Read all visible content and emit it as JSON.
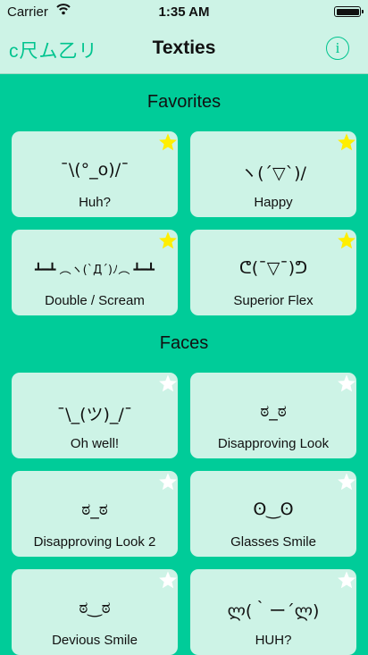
{
  "status_bar": {
    "carrier": "Carrier",
    "time": "1:35 AM"
  },
  "nav": {
    "left_button": "c尺ム乙リ",
    "title": "Texties",
    "info_button": "i"
  },
  "colors": {
    "background": "#00cc99",
    "card": "#cdf3e6",
    "accent": "#00c48f",
    "star_favorite": "#ffee00",
    "star_empty": "#ffffff"
  },
  "sections": [
    {
      "title": "Favorites",
      "items": [
        {
          "face": "¯\\(°_o)/¯",
          "label": "Huh?",
          "favorite": true,
          "star_icon": "star-filled-icon"
        },
        {
          "face": "ヽ(´▽`)/",
          "label": "Happy",
          "favorite": true,
          "star_icon": "star-filled-icon"
        },
        {
          "face": "┻━┻ ︵ヽ(`Д´)ﾉ︵ ┻━┻",
          "label": "Double / Scream",
          "favorite": true,
          "star_icon": "star-filled-icon"
        },
        {
          "face": "ᕦ(¯▽¯)ᕤ",
          "label": "Superior Flex",
          "favorite": true,
          "star_icon": "star-filled-icon"
        }
      ]
    },
    {
      "title": "Faces",
      "items": [
        {
          "face": "¯\\_(ツ)_/¯",
          "label": "Oh well!",
          "favorite": false,
          "star_icon": "star-empty-icon"
        },
        {
          "face": "ಠ_ಠ",
          "label": "Disapproving Look",
          "favorite": false,
          "star_icon": "star-empty-icon"
        },
        {
          "face": "ಠ_ಠ",
          "label": "Disapproving Look 2",
          "favorite": false,
          "star_icon": "star-empty-icon"
        },
        {
          "face": "ʘ‿ʘ",
          "label": "Glasses Smile",
          "favorite": false,
          "star_icon": "star-empty-icon"
        },
        {
          "face": "ಠ‿ಠ",
          "label": "Devious Smile",
          "favorite": false,
          "star_icon": "star-empty-icon"
        },
        {
          "face": "ლ(｀ー´ლ)",
          "label": "HUH?",
          "favorite": false,
          "star_icon": "star-empty-icon"
        }
      ]
    }
  ]
}
